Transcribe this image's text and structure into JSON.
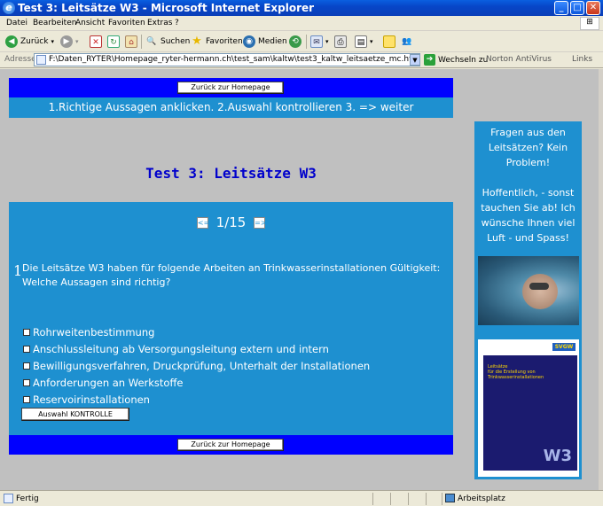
{
  "window": {
    "title": "Test 3: Leitsätze W3 - Microsoft Internet Explorer",
    "controls": {
      "minimize": "_",
      "maximize": "□",
      "close": "✕"
    }
  },
  "menu": [
    "Datei",
    "Bearbeiten",
    "Ansicht",
    "Favoriten",
    "Extras",
    "?"
  ],
  "toolbar": {
    "back": "Zurück",
    "search": "Suchen",
    "favorites": "Favoriten",
    "media": "Medien"
  },
  "address": {
    "label": "Adresse",
    "url": "F:\\Daten_RYTER\\Homepage_ryter-hermann.ch\\test_sam\\kaltw\\test3_kaltw_leitsaetze_mc.html",
    "go": "Wechseln zu",
    "antivirus": "Norton AntiVirus",
    "links": "Links"
  },
  "page": {
    "home_button": "Zurück zur Homepage",
    "instructions": "1.Richtige Aussagen anklicken. 2.Auswahl kontrollieren 3. => weiter",
    "title": "Test 3: Leitsätze W3",
    "pager": {
      "prev": "<=",
      "current": "1/15",
      "next": "=>"
    },
    "question_number": "1",
    "question": "Die Leitsätze W3 haben für folgende Arbeiten an Trinkwasserinstallationen Gültigkeit: Welche Aussagen sind richtig?",
    "options": [
      "Rohrweitenbestimmung",
      "Anschlussleitung ab Versorgungsleitung extern und intern",
      "Bewilligungsverfahren, Druckprüfung, Unterhalt der Installationen",
      "Anforderungen an Werkstoffe",
      "Reservoirinstallationen"
    ],
    "check_button": "Auswahl KONTROLLE",
    "home_button_bottom": "Zurück zur Homepage"
  },
  "sidebar": {
    "text": "Fragen aus den Leitsätzen? Kein Problem!\n\nHoffentlich, - sonst tauchen Sie ab! Ich wünsche Ihnen viel Luft - und Spass!",
    "doc_w3": "W3"
  },
  "status": {
    "left": "Fertig",
    "zone": "Arbeitsplatz"
  }
}
